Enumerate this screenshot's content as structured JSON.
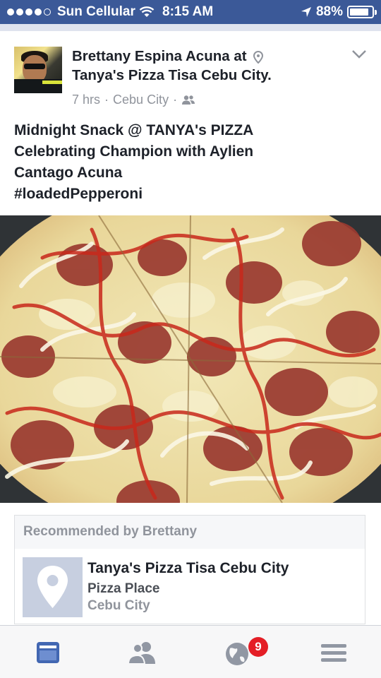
{
  "status_bar": {
    "carrier": "Sun Cellular",
    "time": "8:15 AM",
    "battery": "88%",
    "battery_level": 0.88,
    "signal_bars_filled": 4,
    "signal_bars_total": 5
  },
  "post": {
    "author": "Brettany Espina Acuna",
    "at_word": "at",
    "place": "Tanya's Pizza Tisa Cebu City.",
    "time_ago": "7 hrs",
    "location": "Cebu City",
    "separator": "·",
    "text_lines": [
      "Midnight Snack @ TANYA's PIZZA",
      "Celebrating Champion with Aylien",
      "Cantago Acuna",
      "#loadedPepperoni"
    ]
  },
  "recommendation": {
    "header": "Recommended by Brettany",
    "place_name": "Tanya's Pizza Tisa Cebu City",
    "category": "Pizza Place",
    "city": "Cebu City"
  },
  "tabbar": {
    "tabs": [
      "news-feed-icon",
      "friends-icon",
      "notifications-globe-icon",
      "menu-icon"
    ],
    "notification_count": "9",
    "active_color": "#4267b2",
    "inactive_color": "#9197a3"
  },
  "colors": {
    "status_bar": "#3b5998",
    "badge": "#e41e26"
  }
}
